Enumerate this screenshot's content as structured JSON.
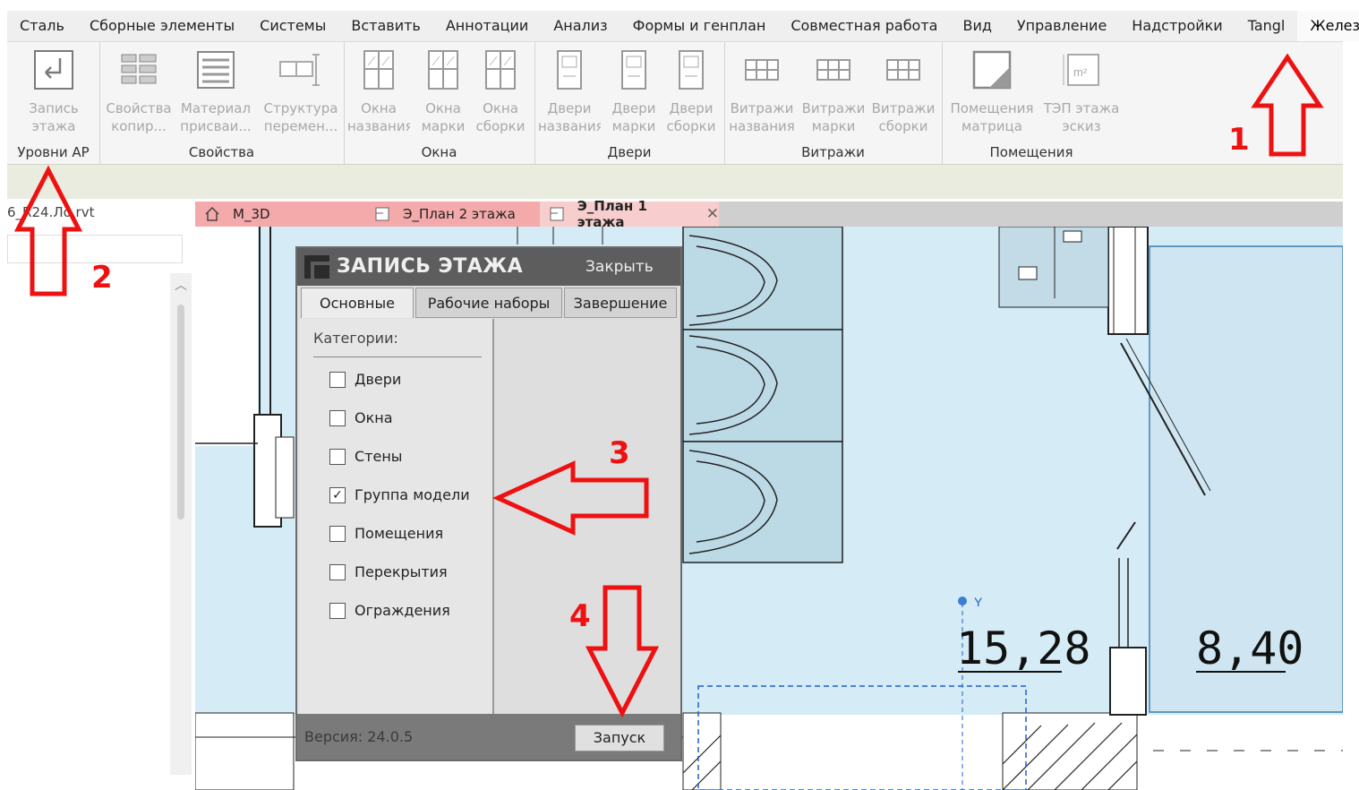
{
  "menu": {
    "items": [
      "Сталь",
      "Сборные элементы",
      "Системы",
      "Вставить",
      "Аннотации",
      "Анализ",
      "Формы и генплан",
      "Совместная работа",
      "Вид",
      "Управление",
      "Надстройки",
      "Tangl",
      "Железно"
    ],
    "active_index": 12
  },
  "ribbon": {
    "groups": [
      {
        "label": "Уровни АР",
        "buttons": [
          {
            "l1": "Запись",
            "l2": "этажа",
            "icon": "floor-record-icon"
          }
        ]
      },
      {
        "label": "Свойства",
        "buttons": [
          {
            "l1": "Свойства",
            "l2": "копир...",
            "icon": "copy-properties-icon"
          },
          {
            "l1": "Материал",
            "l2": "присваи...",
            "icon": "material-assign-icon"
          },
          {
            "l1": "Структура",
            "l2": "перемен...",
            "icon": "structure-rename-icon"
          }
        ]
      },
      {
        "label": "Окна",
        "buttons": [
          {
            "l1": "Окна",
            "l2": "названия",
            "icon": "window-icon"
          },
          {
            "l1": "Окна",
            "l2": "марки",
            "icon": "window-icon"
          },
          {
            "l1": "Окна",
            "l2": "сборки",
            "icon": "window-icon"
          }
        ]
      },
      {
        "label": "Двери",
        "buttons": [
          {
            "l1": "Двери",
            "l2": "названия",
            "icon": "door-icon"
          },
          {
            "l1": "Двери",
            "l2": "марки",
            "icon": "door-icon"
          },
          {
            "l1": "Двери",
            "l2": "сборки",
            "icon": "door-icon"
          }
        ]
      },
      {
        "label": "Витражи",
        "buttons": [
          {
            "l1": "Витражи",
            "l2": "названия",
            "icon": "curtain-wall-icon"
          },
          {
            "l1": "Витражи",
            "l2": "марки",
            "icon": "curtain-wall-icon"
          },
          {
            "l1": "Витражи",
            "l2": "сборки",
            "icon": "curtain-wall-icon"
          }
        ]
      },
      {
        "label": "Помещения",
        "buttons": [
          {
            "l1": "Помещения",
            "l2": "матрица",
            "icon": "room-matrix-icon"
          },
          {
            "l1": "ТЭП этажа",
            "l2": "эскиз",
            "icon": "area-m2-icon"
          }
        ]
      }
    ]
  },
  "project": {
    "file_title": "6_R24.Ло.rvt"
  },
  "tabs": [
    {
      "label": "M_3D",
      "icon": "home-icon",
      "color": "#f4aaaa"
    },
    {
      "label": "Э_План 2 этажа",
      "icon": "plan-view-icon",
      "color": "#f4aaaa"
    },
    {
      "label": "Э_План 1 этажа",
      "icon": "plan-view-icon",
      "color": "#f7cdcd",
      "active": true
    }
  ],
  "canvas": {
    "room_labels": [
      "15,28",
      "8,40"
    ],
    "axis_label": "Y",
    "colors": {
      "room_fill": "#d5ebf5",
      "line": "#222222",
      "dash": "#1f5fcc"
    }
  },
  "dialog": {
    "title": "ЗАПИСЬ ЭТАЖА",
    "close_label": "Закрыть",
    "tabs": [
      "Основные",
      "Рабочие наборы",
      "Завершение"
    ],
    "categories_label": "Категории:",
    "categories": [
      {
        "label": "Двери",
        "checked": false
      },
      {
        "label": "Окна",
        "checked": false
      },
      {
        "label": "Стены",
        "checked": false
      },
      {
        "label": "Группа модели",
        "checked": true
      },
      {
        "label": "Помещения",
        "checked": false
      },
      {
        "label": "Перекрытия",
        "checked": false
      },
      {
        "label": "Ограждения",
        "checked": false
      }
    ],
    "version": "Версия: 24.0.5",
    "run_label": "Запуск"
  },
  "annotations": {
    "n1": "1",
    "n2": "2",
    "n3": "3",
    "n4": "4",
    "color": "#e11111"
  }
}
